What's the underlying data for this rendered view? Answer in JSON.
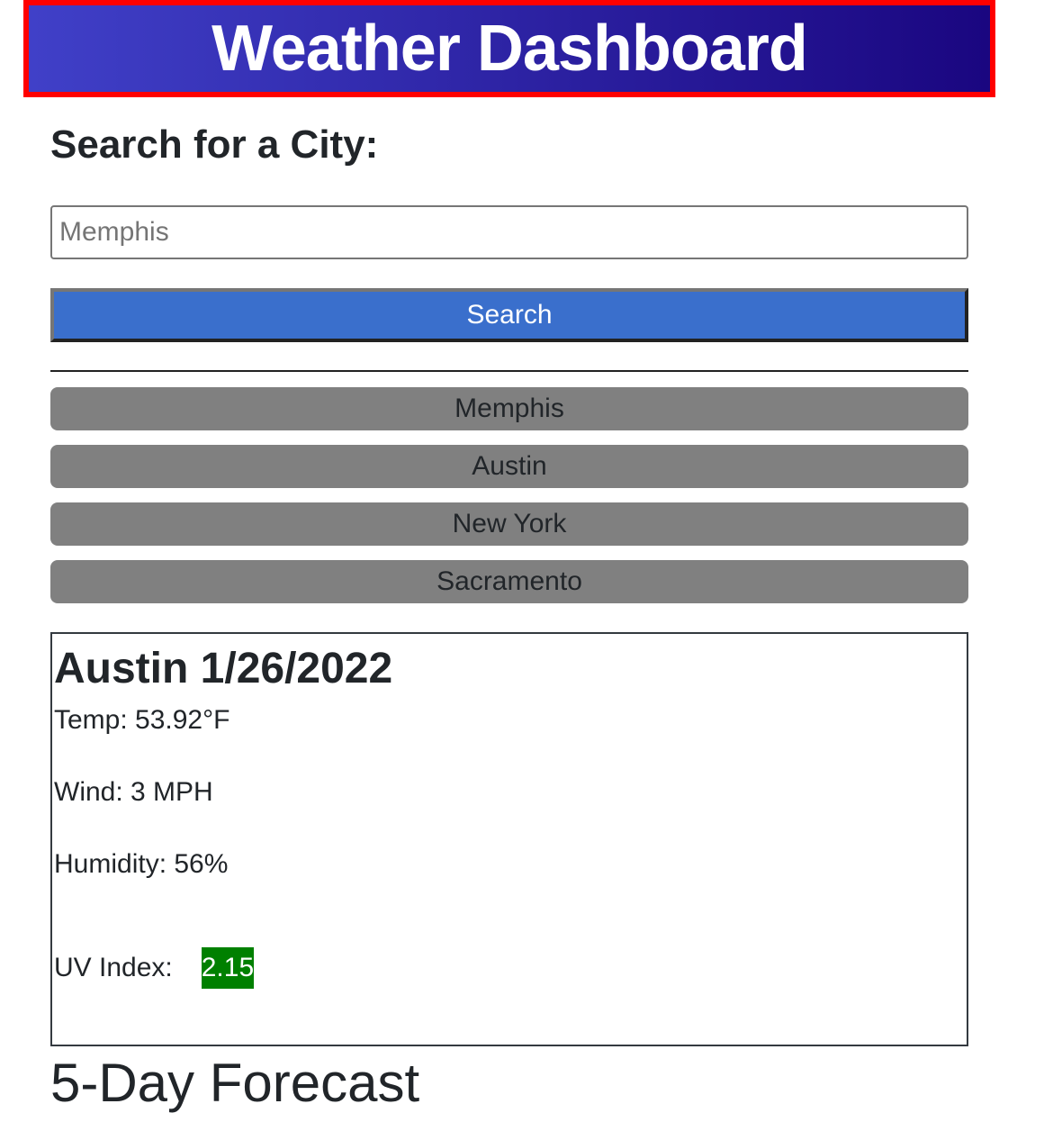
{
  "header": {
    "title": "Weather Dashboard"
  },
  "search": {
    "heading": "Search for a City:",
    "placeholder": "Memphis",
    "value": "",
    "button_label": "Search"
  },
  "history": [
    "Memphis",
    "Austin",
    "New York",
    "Sacramento"
  ],
  "current": {
    "title": "Austin 1/26/2022",
    "temp": "Temp: 53.92°F",
    "wind": "Wind: 3 MPH",
    "humidity": "Humidity: 56%",
    "uv_label": "UV Index:",
    "uv_value": "2.15",
    "uv_color": "#008000"
  },
  "forecast": {
    "heading": "5-Day Forecast"
  },
  "colors": {
    "header_border": "#ff0000",
    "header_gradient": [
      "#4040c8",
      "#1a0680"
    ],
    "search_button": "#3a6fcc",
    "history_button": "#808080"
  }
}
